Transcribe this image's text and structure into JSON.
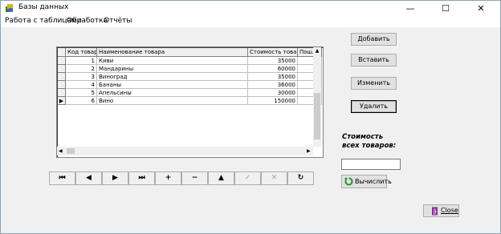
{
  "window": {
    "title": "Базы данных",
    "minimize": "—",
    "maximize": "☐",
    "close": "✕"
  },
  "menu": {
    "items": [
      "Работа с таблицами",
      "Обработка",
      "Отчёты"
    ]
  },
  "grid": {
    "columns": [
      "Код товара",
      "Наименование товара",
      "Стоимость товара",
      "Пошли"
    ],
    "rows": [
      {
        "id": "1",
        "name": "Киви",
        "price": "35000"
      },
      {
        "id": "2",
        "name": "Мандарины",
        "price": "60000"
      },
      {
        "id": "3",
        "name": "Виноград",
        "price": "35000"
      },
      {
        "id": "4",
        "name": "Бананы",
        "price": "36000"
      },
      {
        "id": "5",
        "name": "Апельсины",
        "price": "30000"
      },
      {
        "id": "6",
        "name": "Вино",
        "price": "150000"
      }
    ],
    "current_row_marker": "▶",
    "current_row_index": 6
  },
  "actions": {
    "add": "Добавить",
    "insert": "Вставить",
    "edit": "Изменить",
    "delete": "Удалить"
  },
  "total": {
    "label_line1": "Стоимость",
    "label_line2": "всех товаров:",
    "value": ""
  },
  "compute_button": "Вычислить",
  "close_button": "Close",
  "navigator": {
    "first": "⏮",
    "prior": "◀",
    "next": "▶",
    "last": "⏭",
    "insert": "+",
    "delete": "−",
    "edit": "▲",
    "post": "✓",
    "cancel": "✕",
    "refresh": "↻"
  }
}
